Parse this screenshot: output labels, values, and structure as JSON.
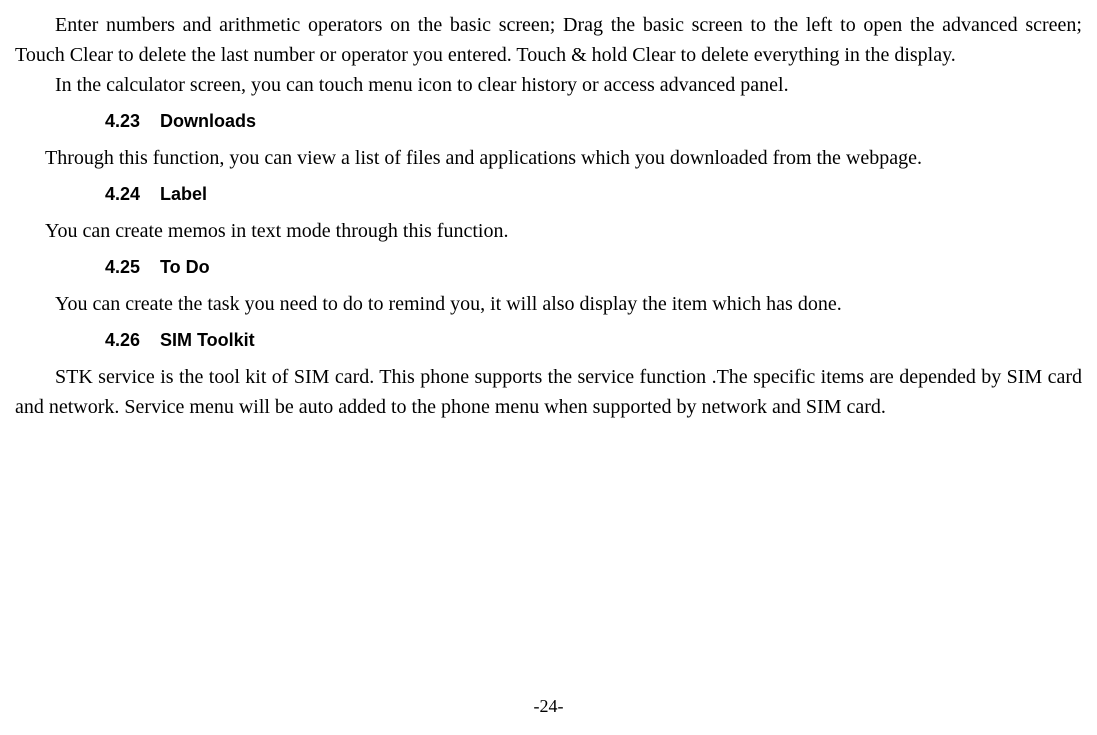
{
  "paragraphs": {
    "p1": "Enter numbers and arithmetic operators on the basic screen; Drag the basic screen to the left to open the advanced screen; Touch Clear to delete the last number or operator you entered. Touch & hold Clear to delete everything in the display.",
    "p2": "In the calculator screen, you can touch menu icon to clear history or access advanced panel.",
    "p3": "Through this function, you can view a list of files and applications which you downloaded from the webpage.",
    "p4": "You can create memos in text mode through this function.",
    "p5": "You can create the task you need to do to remind you, it will also display the item which has done.",
    "p6": "STK service is the tool kit of SIM card. This phone supports the service function .The specific items are depended by SIM card and network. Service menu will be auto added to the phone menu when supported by network and SIM card."
  },
  "headings": {
    "h1_num": "4.23",
    "h1_title": "Downloads",
    "h2_num": "4.24",
    "h2_title": "Label",
    "h3_num": "4.25",
    "h3_title": "To Do",
    "h4_num": "4.26",
    "h4_title": "SIM Toolkit"
  },
  "page_number": "-24-"
}
